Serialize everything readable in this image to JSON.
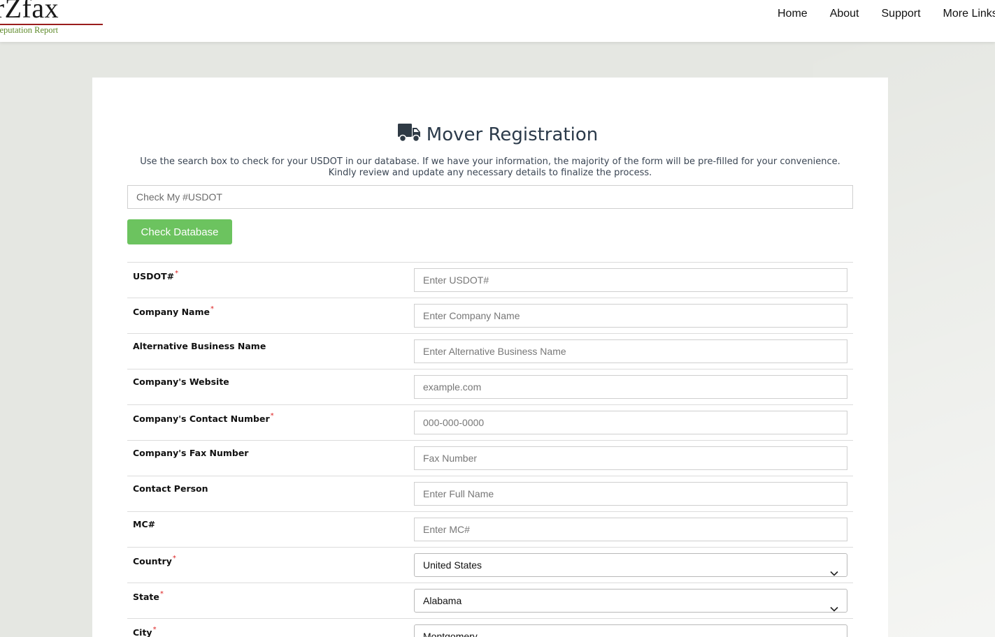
{
  "header": {
    "logo_text": "verZfax",
    "logo_tagline": "mpany Reputation Report",
    "nav": [
      {
        "label": "Home"
      },
      {
        "label": "About"
      },
      {
        "label": "Support"
      },
      {
        "label": "More Links"
      }
    ]
  },
  "page": {
    "title": "Mover Registration",
    "title_icon": "truck-icon",
    "intro": "Use the search box to check for your USDOT in our database. If we have your information, the majority of the form will be pre-filled for your convenience. Kindly review and update any necessary details to finalize the process.",
    "search_placeholder": "Check My #USDOT",
    "check_button": "Check Database",
    "accent_color": "#6cc35f"
  },
  "form": {
    "fields": [
      {
        "label": "USDOT#",
        "required": true,
        "placeholder": "Enter USDOT#"
      },
      {
        "label": "Company Name",
        "required": true,
        "placeholder": "Enter Company Name"
      },
      {
        "label": "Alternative Business Name",
        "required": false,
        "placeholder": "Enter Alternative Business Name"
      },
      {
        "label": "Company's Website",
        "required": false,
        "placeholder": "example.com"
      },
      {
        "label": "Company's Contact Number",
        "required": true,
        "placeholder": "000-000-0000"
      },
      {
        "label": "Company's Fax Number",
        "required": false,
        "placeholder": "Fax Number"
      },
      {
        "label": "Contact Person",
        "required": false,
        "placeholder": "Enter Full Name"
      },
      {
        "label": "MC#",
        "required": false,
        "placeholder": "Enter MC#"
      }
    ],
    "selects": [
      {
        "label": "Country",
        "required": true,
        "value": "United States"
      },
      {
        "label": "State",
        "required": true,
        "value": "Alabama"
      },
      {
        "label": "City",
        "required": true,
        "value": "Montgomery"
      }
    ],
    "required_marker": "*"
  }
}
